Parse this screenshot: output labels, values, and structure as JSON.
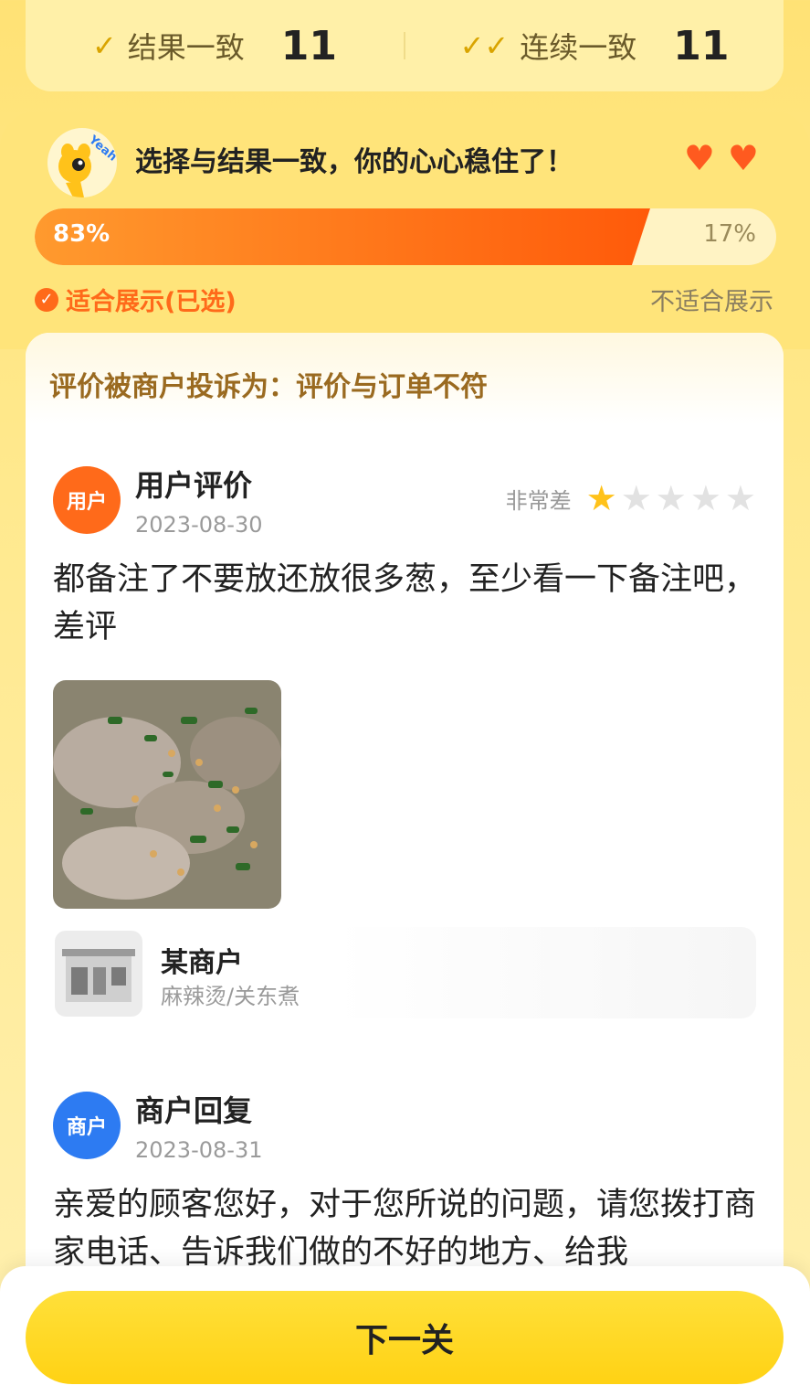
{
  "stats": {
    "result_match_label": "结果一致",
    "result_match_value": "11",
    "streak_label": "连续一致",
    "streak_value": "11"
  },
  "result": {
    "mascot_text": "Yeah",
    "message": "选择与结果一致，你的心心稳住了！",
    "hearts": 2,
    "left_percent_label": "83%",
    "right_percent_label": "17%",
    "left_fraction": 0.83,
    "left_option": "适合展示(已选)",
    "right_option": "不适合展示"
  },
  "complaint": {
    "text": "评价被商户投诉为：评价与订单不符"
  },
  "review": {
    "badge": "用户",
    "title": "用户评价",
    "date": "2023-08-30",
    "rating_label": "非常差",
    "rating": 1,
    "rating_max": 5,
    "text": "都备注了不要放还放很多葱，至少看一下备注吧，差评"
  },
  "store": {
    "name": "某商户",
    "category": "麻辣烫/关东煮"
  },
  "reply": {
    "badge": "商户",
    "title": "商户回复",
    "date": "2023-08-31",
    "text": "亲爱的顾客您好，对于您所说的问题，请您拨打商家电话、告诉我们做的不好的地方、给我"
  },
  "button": {
    "next_label": "下一关"
  },
  "colors": {
    "accent": "#ff6a1a",
    "merchant": "#2d7bf2",
    "star": "#ffc21a",
    "button": "#ffd214"
  }
}
